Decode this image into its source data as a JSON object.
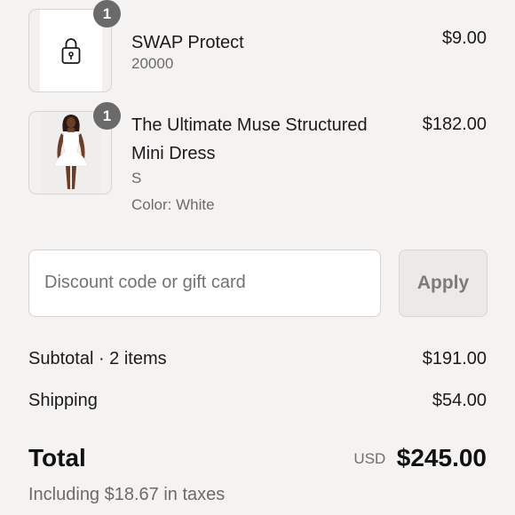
{
  "cart": {
    "items": [
      {
        "quantity": "1",
        "title": "SWAP Protect",
        "subtitle": "20000",
        "price": "$9.00",
        "thumbnail_icon": "lock-icon"
      },
      {
        "quantity": "1",
        "title": "The Ultimate Muse Structured Mini Dress",
        "size": "S",
        "color": "Color: White",
        "price": "$182.00"
      }
    ]
  },
  "discount": {
    "placeholder": "Discount code or gift card",
    "apply_label": "Apply"
  },
  "summary": {
    "subtotal_label": "Subtotal · 2 items",
    "subtotal_value": "$191.00",
    "shipping_label": "Shipping",
    "shipping_value": "$54.00",
    "total_label": "Total",
    "currency": "USD",
    "total_value": "$245.00",
    "tax_note": "Including $18.67 in taxes"
  },
  "colors": {
    "background": "#f5f3f1",
    "badge": "#6a6a6a",
    "text": "#1a1a1a",
    "muted_text": "#6b6b6b"
  }
}
